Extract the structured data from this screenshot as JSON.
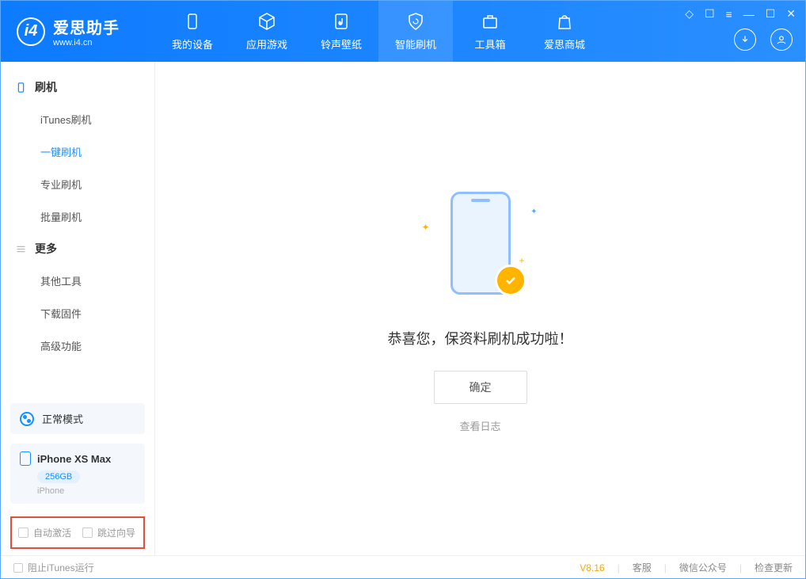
{
  "app": {
    "name": "爱思助手",
    "url": "www.i4.cn"
  },
  "nav": {
    "items": [
      {
        "label": "我的设备"
      },
      {
        "label": "应用游戏"
      },
      {
        "label": "铃声壁纸"
      },
      {
        "label": "智能刷机"
      },
      {
        "label": "工具箱"
      },
      {
        "label": "爱思商城"
      }
    ],
    "active_index": 3
  },
  "sidebar": {
    "group1": {
      "title": "刷机",
      "items": [
        "iTunes刷机",
        "一键刷机",
        "专业刷机",
        "批量刷机"
      ],
      "active_index": 1
    },
    "group2": {
      "title": "更多",
      "items": [
        "其他工具",
        "下载固件",
        "高级功能"
      ]
    },
    "mode": "正常模式",
    "device": {
      "name": "iPhone XS Max",
      "capacity": "256GB",
      "type": "iPhone"
    },
    "opts": {
      "opt1": "自动激活",
      "opt2": "跳过向导"
    }
  },
  "main": {
    "message": "恭喜您，保资料刷机成功啦！",
    "ok_button": "确定",
    "log_link": "查看日志"
  },
  "statusbar": {
    "block_itunes": "阻止iTunes运行",
    "version": "V8.16",
    "links": [
      "客服",
      "微信公众号",
      "检查更新"
    ]
  }
}
